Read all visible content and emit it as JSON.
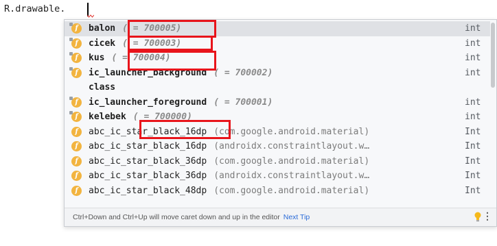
{
  "editor": {
    "code": "R.drawable."
  },
  "completion": {
    "items": [
      {
        "name": "balon",
        "hint": "( = 700005)",
        "package": "",
        "type": "int"
      },
      {
        "name": "cicek",
        "hint": "( = 700003)",
        "package": "",
        "type": "int"
      },
      {
        "name": "kus",
        "hint": "( = 700004)",
        "package": "",
        "type": "int"
      },
      {
        "name": "ic_launcher_background",
        "hint": "( = 700002)",
        "package": "",
        "type": "int"
      },
      {
        "name": "class",
        "hint": "",
        "package": "",
        "type": ""
      },
      {
        "name": "ic_launcher_foreground",
        "hint": "( = 700001)",
        "package": "",
        "type": "int"
      },
      {
        "name": "kelebek",
        "hint": "( = 700000)",
        "package": "",
        "type": "int"
      },
      {
        "name": "abc_ic_star_black_16dp",
        "hint": "",
        "package": "(com.google.android.material)",
        "type": "Int"
      },
      {
        "name": "abc_ic_star_black_16dp",
        "hint": "",
        "package": "(androidx.constraintlayout.w…",
        "type": "Int"
      },
      {
        "name": "abc_ic_star_black_36dp",
        "hint": "",
        "package": "(com.google.android.material)",
        "type": "Int"
      },
      {
        "name": "abc_ic_star_black_36dp",
        "hint": "",
        "package": "(androidx.constraintlayout.w…",
        "type": "Int"
      },
      {
        "name": "abc_ic_star_black_48dp",
        "hint": "",
        "package": "(com.google.android.material)",
        "type": "Int"
      }
    ],
    "footer": {
      "tip": "Ctrl+Down and Ctrl+Up will move caret down and up in the editor",
      "link": "Next Tip"
    }
  },
  "colors": {
    "highlight": "#e8141b",
    "field_icon": "#f2b440",
    "link": "#2a6bd8"
  },
  "icons": {
    "field": "field-icon",
    "bulb": "lightbulb-icon",
    "more": "more-options-icon"
  }
}
